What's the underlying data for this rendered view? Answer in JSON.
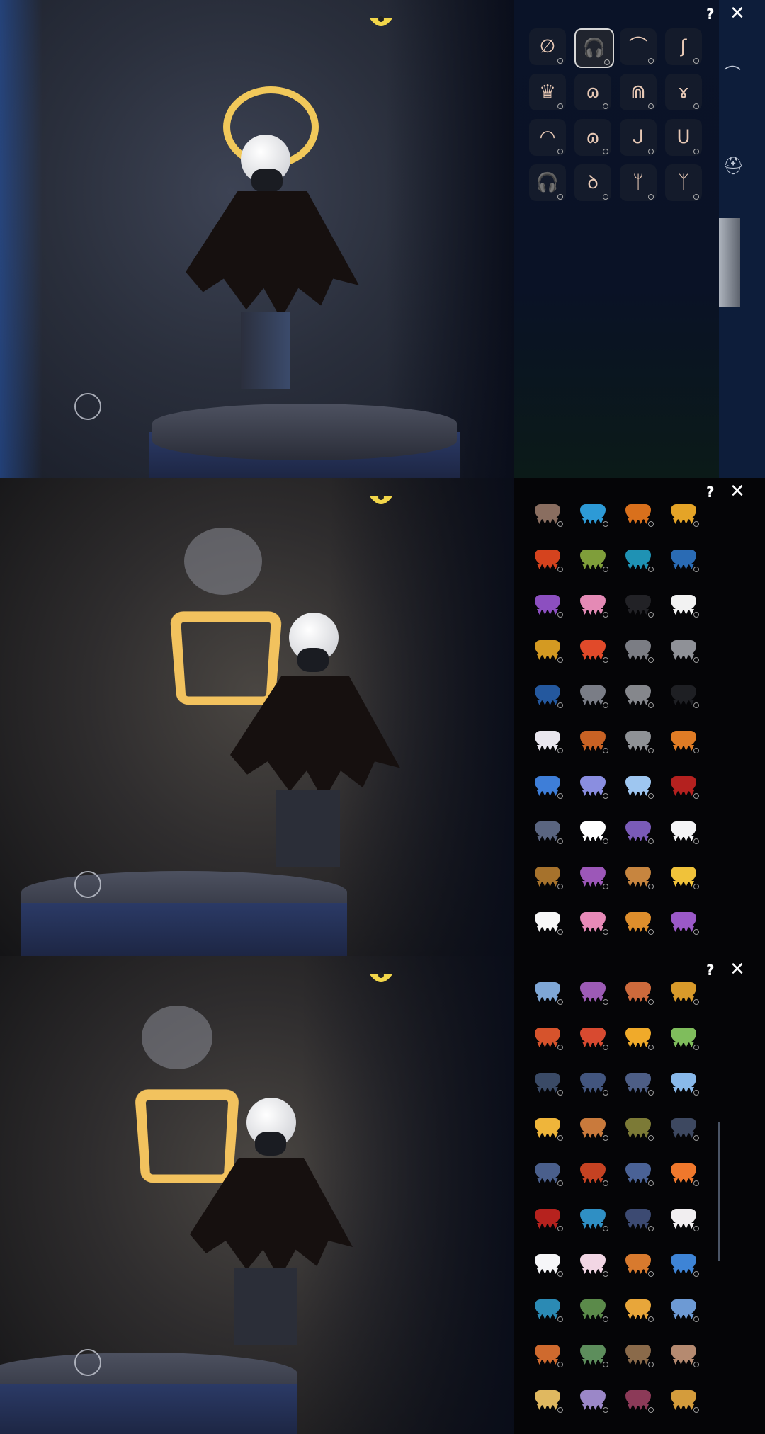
{
  "header": {
    "help_label": "?",
    "close_label": "✕"
  },
  "panels": [
    {
      "id": "hair-accessories",
      "accessories": [
        {
          "icon": "none-icon",
          "glyph": "∅"
        },
        {
          "icon": "headphones-icon",
          "glyph": "🎧",
          "selected": true
        },
        {
          "icon": "horns-icon",
          "glyph": "⌒"
        },
        {
          "icon": "earring-icon",
          "glyph": "ʃ"
        },
        {
          "icon": "crown-icon",
          "glyph": "♛"
        },
        {
          "icon": "antenna-icon",
          "glyph": "ɷ"
        },
        {
          "icon": "ribbon-icon",
          "glyph": "⋒"
        },
        {
          "icon": "bow-icon",
          "glyph": "ɤ"
        },
        {
          "icon": "band-icon",
          "glyph": "◠"
        },
        {
          "icon": "tiara-icon",
          "glyph": "ɷ"
        },
        {
          "icon": "hook-icon",
          "glyph": "ᒍ"
        },
        {
          "icon": "loop-icon",
          "glyph": "ᑌ"
        },
        {
          "icon": "earmuffs-icon",
          "glyph": "🎧"
        },
        {
          "icon": "cups-icon",
          "glyph": "ꝺ"
        },
        {
          "icon": "antlers-icon",
          "glyph": "ᛘ"
        },
        {
          "icon": "branch-icon",
          "glyph": "ᛉ"
        }
      ],
      "side_icons": [
        "hair-icon",
        "hat-icon",
        "accessory-icon"
      ]
    },
    {
      "id": "capes-page-1",
      "capes": [
        "#8a6e60",
        "#2d9ad6",
        "#d9701c",
        "#e5a427",
        "#d5431e",
        "#7f9e3a",
        "#1f92b4",
        "#2a6bb4",
        "#8c4fc0",
        "#e48ab5",
        "#222226",
        "#f2f2f2",
        "#d49a22",
        "#e14a2a",
        "#7b7d84",
        "#8f9197",
        "#24589e",
        "#7a7d86",
        "#85878c",
        "#1e1f23",
        "#e9e6ee",
        "#c86224",
        "#8f9296",
        "#e07c25",
        "#3e7ed8",
        "#8a8ee0",
        "#9ec6f0",
        "#b4211f",
        "#5a6580",
        "#ffffff",
        "#7a5bb8",
        "#f4f4f6",
        "#a6722c",
        "#9c57b8",
        "#c7853f",
        "#f0c23a",
        "#f7f7f7",
        "#e88ab8",
        "#de8e2c",
        "#9b59c8"
      ]
    },
    {
      "id": "capes-page-2",
      "capes": [
        "#7fa7d6",
        "#9c5bb5",
        "#cd6a3c",
        "#d99a2a",
        "#d6532c",
        "#d84a30",
        "#f0aa2a",
        "#7fbd5c",
        "#3a4a66",
        "#42557e",
        "#4d5e86",
        "#89b9ea",
        "#efb53a",
        "#c97a3c",
        "#7c7a36",
        "#3d4860",
        "#4a5f8c",
        "#c54222",
        "#4a6296",
        "#f0782c",
        "#b6221e",
        "#2f8fc4",
        "#3c4a72",
        "#f1eef0",
        "#f6f6f8",
        "#f2d6e4",
        "#d87a2e",
        "#3e84d6",
        "#2b8ab4",
        "#5b8a4a",
        "#e8a63a",
        "#6d9ad4",
        "#cf6a2e",
        "#5d8e5c",
        "#8a6a4a",
        "#b58a70",
        "#e0b860",
        "#9b87c8",
        "#8c3a58",
        "#d49c3c"
      ]
    }
  ]
}
